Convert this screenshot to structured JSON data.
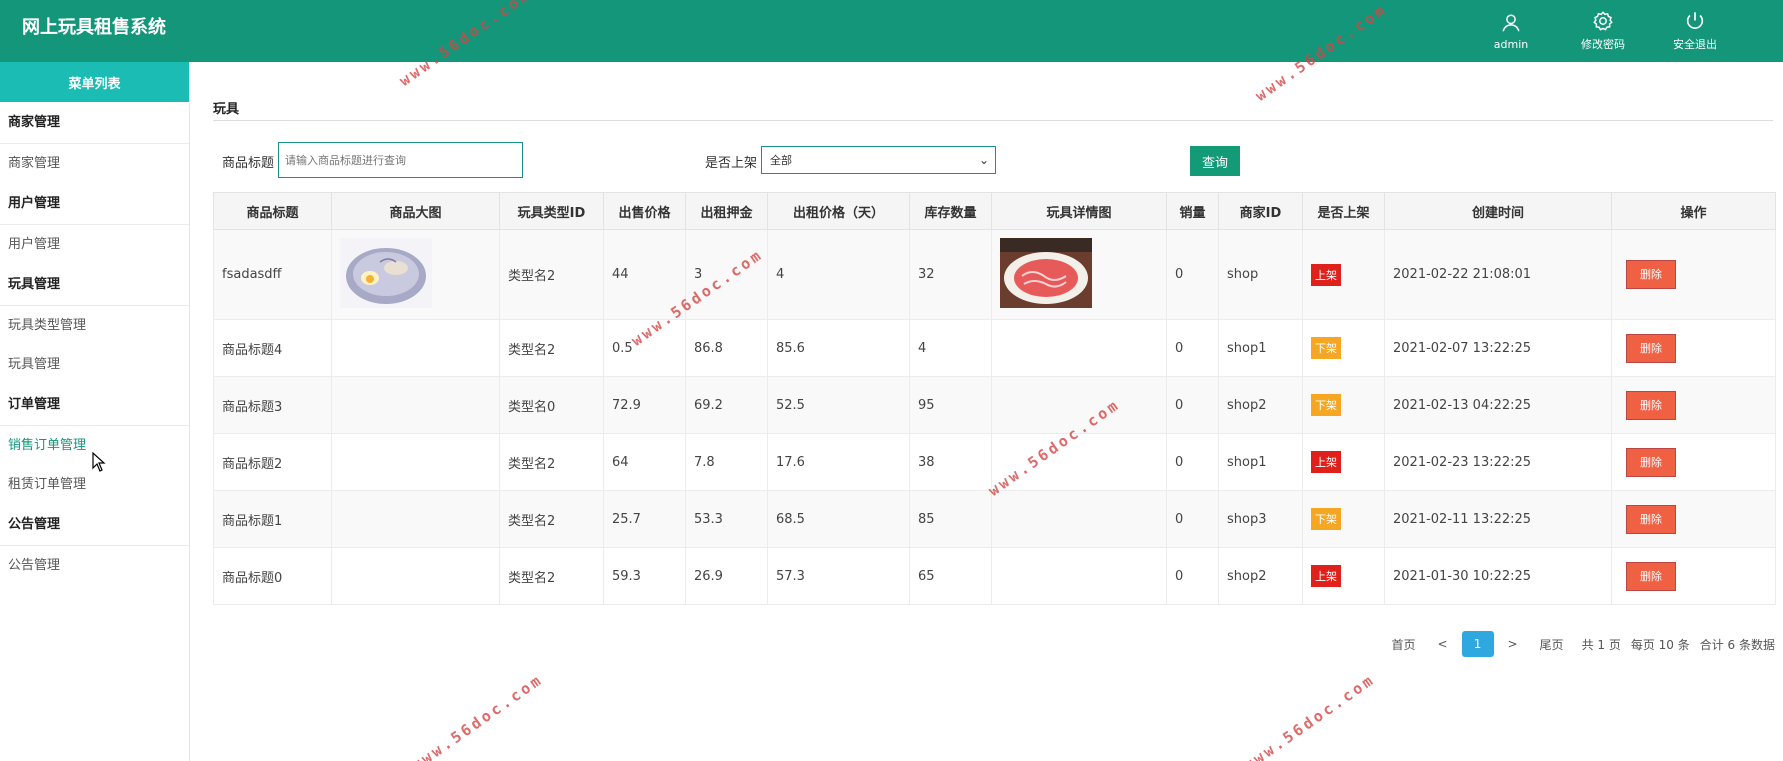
{
  "app": {
    "title": "网上玩具租售系统"
  },
  "header_actions": [
    {
      "label": "admin",
      "icon": "user-icon"
    },
    {
      "label": "修改密码",
      "icon": "gear-icon"
    },
    {
      "label": "安全退出",
      "icon": "power-icon"
    }
  ],
  "sidebar": {
    "title": "菜单列表",
    "groups": [
      {
        "label": "商家管理",
        "items": [
          "商家管理"
        ]
      },
      {
        "label": "用户管理",
        "items": [
          "用户管理"
        ]
      },
      {
        "label": "玩具管理",
        "items": [
          "玩具类型管理",
          "玩具管理"
        ]
      },
      {
        "label": "订单管理",
        "items": [
          "销售订单管理",
          "租赁订单管理"
        ]
      },
      {
        "label": "公告管理",
        "items": [
          "公告管理"
        ]
      }
    ],
    "active_item": "销售订单管理"
  },
  "page": {
    "section_title": "玩具"
  },
  "search": {
    "title_label": "商品标题",
    "title_placeholder": "请输入商品标题进行查询",
    "status_label": "是否上架",
    "status_value": "全部",
    "query_button": "查询"
  },
  "table": {
    "headers": [
      "商品标题",
      "商品大图",
      "玩具类型ID",
      "出售价格",
      "出租押金",
      "出租价格（天）",
      "库存数量",
      "玩具详情图",
      "销量",
      "商家ID",
      "是否上架",
      "创建时间",
      "操作"
    ],
    "rows": [
      {
        "title": "fsadasdff",
        "type": "类型名2",
        "price": "44",
        "deposit": "3",
        "rent": "4",
        "stock": "32",
        "sales": "0",
        "shop": "shop",
        "status": "上架",
        "status_type": "on",
        "created": "2021-02-22 21:08:01",
        "action": "删除"
      },
      {
        "title": "商品标题4",
        "type": "类型名2",
        "price": "0.5",
        "deposit": "86.8",
        "rent": "85.6",
        "stock": "4",
        "sales": "0",
        "shop": "shop1",
        "status": "下架",
        "status_type": "off",
        "created": "2021-02-07 13:22:25",
        "action": "删除"
      },
      {
        "title": "商品标题3",
        "type": "类型名0",
        "price": "72.9",
        "deposit": "69.2",
        "rent": "52.5",
        "stock": "95",
        "sales": "0",
        "shop": "shop2",
        "status": "下架",
        "status_type": "off",
        "created": "2021-02-13 04:22:25",
        "action": "删除"
      },
      {
        "title": "商品标题2",
        "type": "类型名2",
        "price": "64",
        "deposit": "7.8",
        "rent": "17.6",
        "stock": "38",
        "sales": "0",
        "shop": "shop1",
        "status": "上架",
        "status_type": "on",
        "created": "2021-02-23 13:22:25",
        "action": "删除"
      },
      {
        "title": "商品标题1",
        "type": "类型名2",
        "price": "25.7",
        "deposit": "53.3",
        "rent": "68.5",
        "stock": "85",
        "sales": "0",
        "shop": "shop3",
        "status": "下架",
        "status_type": "off",
        "created": "2021-02-11 13:22:25",
        "action": "删除"
      },
      {
        "title": "商品标题0",
        "type": "类型名2",
        "price": "59.3",
        "deposit": "26.9",
        "rent": "57.3",
        "stock": "65",
        "sales": "0",
        "shop": "shop2",
        "status": "上架",
        "status_type": "on",
        "created": "2021-01-30 10:22:25",
        "action": "删除"
      }
    ]
  },
  "pagination": {
    "first": "首页",
    "prev": "<",
    "current": "1",
    "next": ">",
    "last": "尾页",
    "total_pages": "共 1 页",
    "per_page": "每页 10 条",
    "total_count": "合计 6 条数据"
  },
  "watermark": "www.56doc.com",
  "colors": {
    "header": "#14967a",
    "menu_title": "#1abcb3",
    "on_badge": "#e0211b",
    "off_badge": "#f5a623",
    "delete": "#f06043",
    "query": "#139b78",
    "pager_current": "#2fa8e0"
  }
}
